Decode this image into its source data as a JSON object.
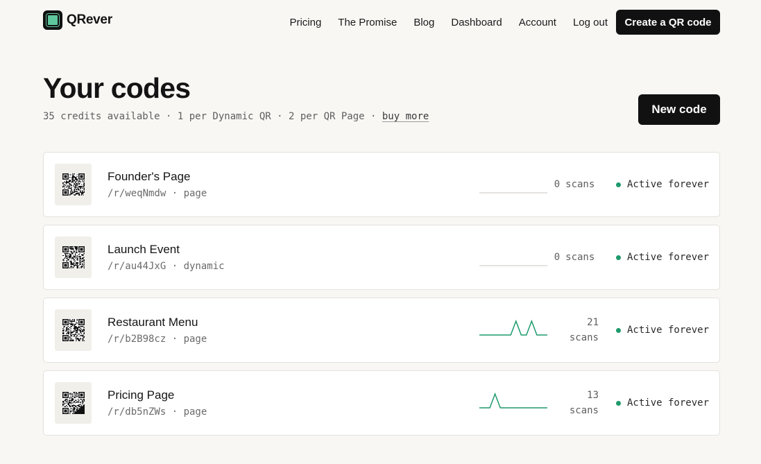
{
  "brand": {
    "name": "QRever"
  },
  "nav": {
    "items": [
      {
        "label": "Pricing"
      },
      {
        "label": "The Promise"
      },
      {
        "label": "Blog"
      },
      {
        "label": "Dashboard"
      },
      {
        "label": "Account"
      },
      {
        "label": "Log out"
      }
    ],
    "cta_label": "Create a QR code"
  },
  "page": {
    "title": "Your codes",
    "credits_info": "35 credits available · 1 per Dynamic QR · 2 per QR Page · ",
    "buy_more_label": "buy more",
    "new_code_label": "New code"
  },
  "codes": [
    {
      "name": "Founder's Page",
      "meta": "/r/weqNmdw · page",
      "scans_count": "0",
      "scans_unit": "scans",
      "status": "Active forever",
      "sparkline": [
        0,
        0,
        0,
        0,
        0,
        0,
        0,
        0,
        0,
        0,
        0,
        0,
        0,
        0
      ],
      "qr_variant": 1
    },
    {
      "name": "Launch Event",
      "meta": "/r/au44JxG · dynamic",
      "scans_count": "0",
      "scans_unit": "scans",
      "status": "Active forever",
      "sparkline": [
        0,
        0,
        0,
        0,
        0,
        0,
        0,
        0,
        0,
        0,
        0,
        0,
        0,
        0
      ],
      "qr_variant": 2
    },
    {
      "name": "Restaurant Menu",
      "meta": "/r/b2B98cz · page",
      "scans_count": "21",
      "scans_unit": "scans",
      "status": "Active forever",
      "sparkline": [
        0,
        0,
        0,
        0,
        0,
        0,
        0,
        10,
        0,
        0,
        10,
        0,
        0,
        0
      ],
      "qr_variant": 3
    },
    {
      "name": "Pricing Page",
      "meta": "/r/db5nZWs · page",
      "scans_count": "13",
      "scans_unit": "scans",
      "status": "Active forever",
      "sparkline": [
        0,
        0,
        0,
        10,
        0,
        0,
        0,
        0,
        0,
        0,
        0,
        0,
        0,
        0
      ],
      "qr_variant": 4
    }
  ],
  "colors": {
    "accent": "#1e9a6c",
    "logo_green": "#5fc79c",
    "button_bg": "#111111",
    "page_bg": "#f8f7f4"
  }
}
